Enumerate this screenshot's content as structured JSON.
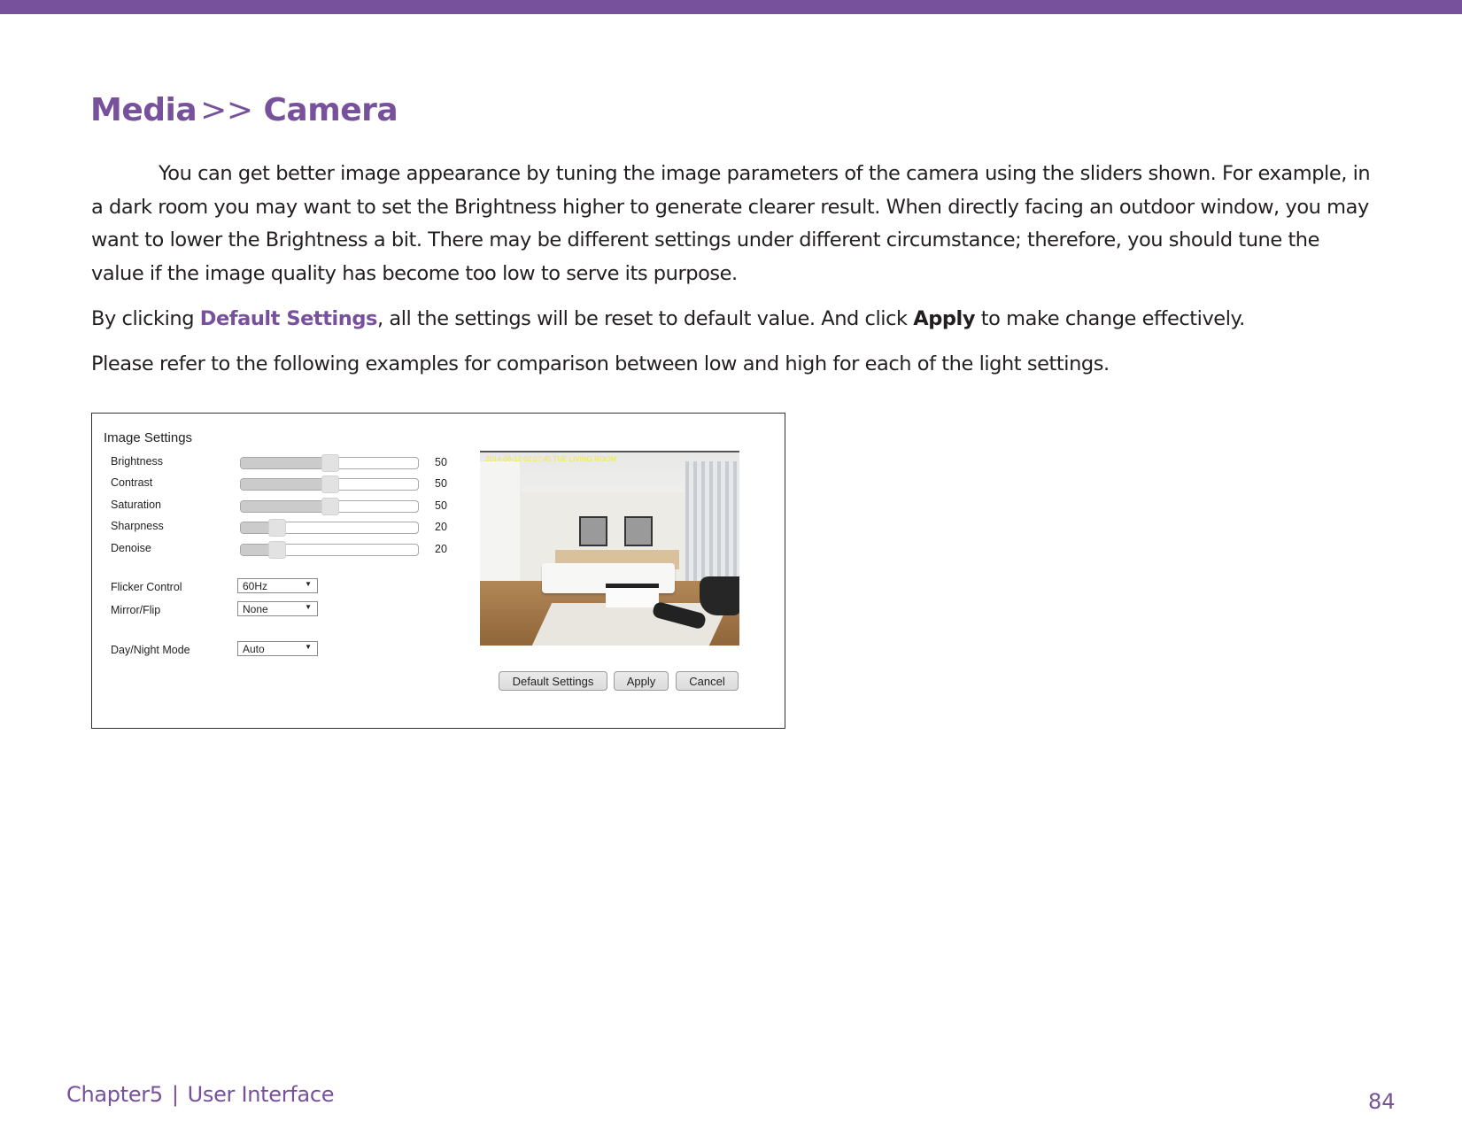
{
  "page": {
    "accent_color": "#77519c",
    "breadcrumb": {
      "section": "Media",
      "separator": ">>",
      "page": "Camera"
    },
    "paragraphs": {
      "intro": "You can get better image appearance by tuning the image parameters of the camera using the sliders shown. For example, in a dark room you may want to set the Brightness higher to generate clearer result. When directly facing an outdoor window, you may want to lower the Brightness a bit. There may be different settings under different circumstance; therefore, you should tune the value if the image quality has become too low to serve its purpose.",
      "defaults_prefix": "By clicking ",
      "defaults_link": "Default Settings",
      "defaults_middle": ", all the settings will be reset to default value. And click ",
      "apply_term": "Apply",
      "defaults_suffix": " to make change effectively.",
      "examples": "Please refer to the following examples for comparison between low and high for each of the light settings."
    },
    "footer": {
      "chapter": "Chapter5",
      "divider": "|",
      "section": "User Interface",
      "page_number": "84"
    }
  },
  "screenshot": {
    "panel_title": "Image Settings",
    "sliders": [
      {
        "label": "Brightness",
        "value": "50",
        "fraction": 0.5
      },
      {
        "label": "Contrast",
        "value": "50",
        "fraction": 0.5
      },
      {
        "label": "Saturation",
        "value": "50",
        "fraction": 0.5
      },
      {
        "label": "Sharpness",
        "value": "20",
        "fraction": 0.2
      },
      {
        "label": "Denoise",
        "value": "20",
        "fraction": 0.2
      }
    ],
    "selects": [
      {
        "label": "Flicker Control",
        "value": "60Hz"
      },
      {
        "label": "Mirror/Flip",
        "value": "None"
      },
      {
        "label": "Day/Night Mode",
        "value": "Auto"
      }
    ],
    "select_arrow": "▼",
    "camera_osd": "2014-08-12 02:07:45 TUE   LIVING ROOM",
    "buttons": {
      "default_settings": "Default Settings",
      "apply": "Apply",
      "cancel": "Cancel"
    }
  }
}
